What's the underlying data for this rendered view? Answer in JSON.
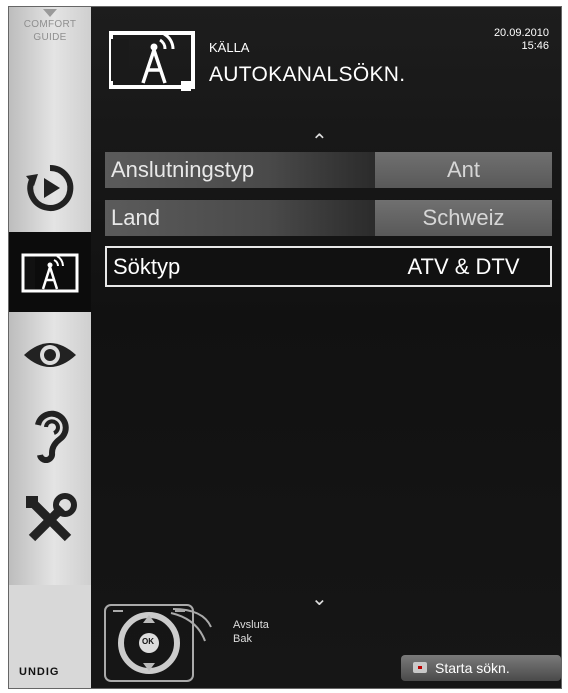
{
  "sidebar": {
    "comfort_guide": "COMFORT\nGUIDE",
    "comfort_line1": "COMFORT",
    "comfort_line2": "GUIDE",
    "items": [
      {
        "icon": "playback-icon",
        "active": false
      },
      {
        "icon": "source-antenna-icon",
        "active": true
      },
      {
        "icon": "eye-icon",
        "active": false
      },
      {
        "icon": "ear-icon",
        "active": false
      },
      {
        "icon": "tools-icon",
        "active": false
      }
    ],
    "brand": "UNDIG"
  },
  "header": {
    "section": "KÄLLA",
    "title": "AUTOKANALSÖKN.",
    "date": "20.09.2010",
    "time": "15:46"
  },
  "settings": [
    {
      "label": "Anslutningstyp",
      "value": "Ant",
      "selected": false
    },
    {
      "label": "Land",
      "value": "Schweiz",
      "selected": false
    },
    {
      "label": "Söktyp",
      "value": "ATV & DTV",
      "selected": true
    }
  ],
  "footer": {
    "remote_hint_1": "Avsluta",
    "remote_hint_2": "Bak",
    "ok_label": "OK",
    "start_button": "Starta sökn."
  },
  "colors": {
    "background": "#111111",
    "sidebar": "#dcdcdc",
    "row_value": "#666666",
    "text": "#ffffff"
  }
}
